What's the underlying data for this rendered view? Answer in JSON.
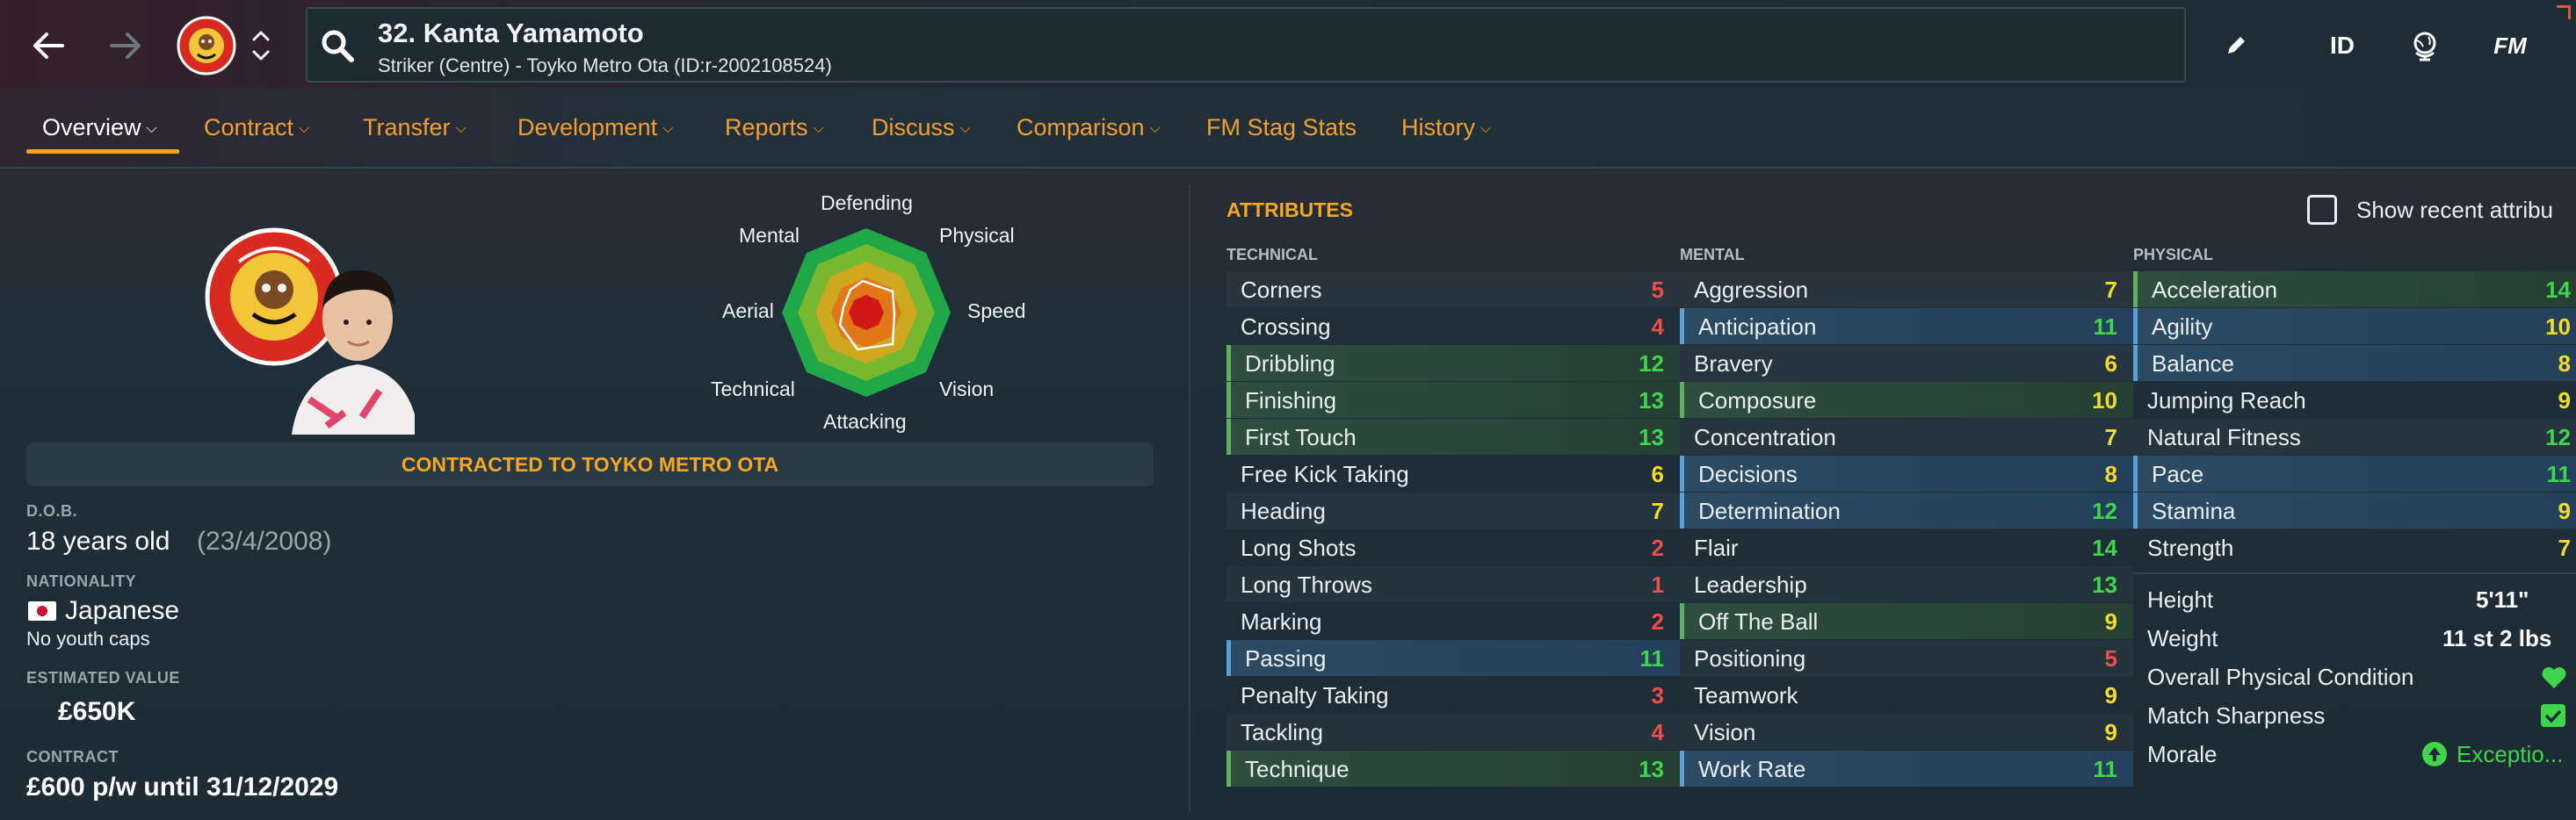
{
  "header": {
    "player_title": "32. Kanta Yamamoto",
    "player_subtitle": "Striker (Centre) - Toyko Metro Ota (ID:r-2002108524)",
    "id_label": "ID",
    "fm_label": "FM"
  },
  "tabs": [
    {
      "label": "Overview",
      "active": true
    },
    {
      "label": "Contract"
    },
    {
      "label": "Transfer"
    },
    {
      "label": "Development"
    },
    {
      "label": "Reports"
    },
    {
      "label": "Discuss"
    },
    {
      "label": "Comparison"
    },
    {
      "label": "FM Stag Stats"
    },
    {
      "label": "History"
    }
  ],
  "radar": {
    "labels": [
      "Defending",
      "Physical",
      "Speed",
      "Vision",
      "Attacking",
      "Technical",
      "Aerial",
      "Mental"
    ]
  },
  "contract_banner": "CONTRACTED TO TOYKO METRO OTA",
  "profile": {
    "dob_label": "D.O.B.",
    "dob_value": "18 years old",
    "dob_date": "(23/4/2008)",
    "nationality_label": "NATIONALITY",
    "nationality_value": "Japanese",
    "youth_caps": "No youth caps",
    "value_label": "ESTIMATED VALUE",
    "value_value": "£650K",
    "contract_label": "CONTRACT",
    "contract_value": "£600 p/w until 31/12/2029"
  },
  "attributes": {
    "title": "ATTRIBUTES",
    "show_recent": "Show recent attribu",
    "technical_label": "TECHNICAL",
    "mental_label": "MENTAL",
    "physical_label": "PHYSICAL",
    "technical": [
      {
        "name": "Corners",
        "value": "5"
      },
      {
        "name": "Crossing",
        "value": "4"
      },
      {
        "name": "Dribbling",
        "value": "12"
      },
      {
        "name": "Finishing",
        "value": "13"
      },
      {
        "name": "First Touch",
        "value": "13"
      },
      {
        "name": "Free Kick Taking",
        "value": "6"
      },
      {
        "name": "Heading",
        "value": "7"
      },
      {
        "name": "Long Shots",
        "value": "2"
      },
      {
        "name": "Long Throws",
        "value": "1"
      },
      {
        "name": "Marking",
        "value": "2"
      },
      {
        "name": "Passing",
        "value": "11"
      },
      {
        "name": "Penalty Taking",
        "value": "3"
      },
      {
        "name": "Tackling",
        "value": "4"
      },
      {
        "name": "Technique",
        "value": "13"
      }
    ],
    "mental": [
      {
        "name": "Aggression",
        "value": "7"
      },
      {
        "name": "Anticipation",
        "value": "11"
      },
      {
        "name": "Bravery",
        "value": "6"
      },
      {
        "name": "Composure",
        "value": "10"
      },
      {
        "name": "Concentration",
        "value": "7"
      },
      {
        "name": "Decisions",
        "value": "8"
      },
      {
        "name": "Determination",
        "value": "12"
      },
      {
        "name": "Flair",
        "value": "14"
      },
      {
        "name": "Leadership",
        "value": "13"
      },
      {
        "name": "Off The Ball",
        "value": "9"
      },
      {
        "name": "Positioning",
        "value": "5"
      },
      {
        "name": "Teamwork",
        "value": "9"
      },
      {
        "name": "Vision",
        "value": "9"
      },
      {
        "name": "Work Rate",
        "value": "11"
      }
    ],
    "physical": [
      {
        "name": "Acceleration",
        "value": "14"
      },
      {
        "name": "Agility",
        "value": "10"
      },
      {
        "name": "Balance",
        "value": "8"
      },
      {
        "name": "Jumping Reach",
        "value": "9"
      },
      {
        "name": "Natural Fitness",
        "value": "12"
      },
      {
        "name": "Pace",
        "value": "11"
      },
      {
        "name": "Stamina",
        "value": "9"
      },
      {
        "name": "Strength",
        "value": "7"
      }
    ]
  },
  "physical_info": {
    "height_label": "Height",
    "height_value": "5'11\"",
    "weight_label": "Weight",
    "weight_value": "11 st 2 lbs",
    "condition_label": "Overall Physical Condition",
    "sharpness_label": "Match Sharpness",
    "morale_label": "Morale",
    "morale_value": "Exceptio..."
  },
  "colors": {
    "accent": "#f5a623",
    "green": "#3fd64c",
    "yellow": "#f2dc2a",
    "red": "#ef4d4d",
    "blue_hl": "#24405a",
    "green_hl": "#263f35"
  }
}
